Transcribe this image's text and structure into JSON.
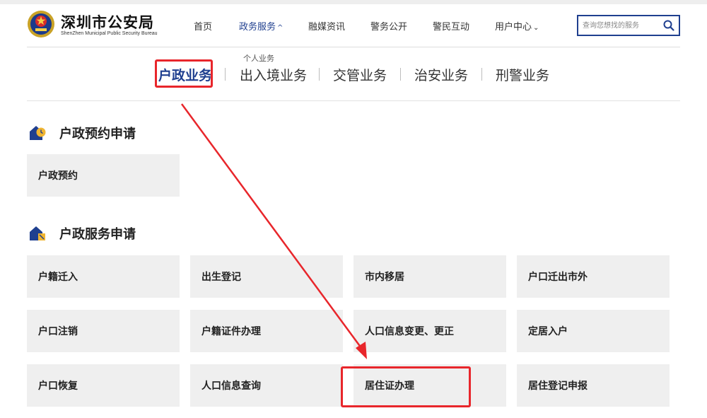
{
  "header": {
    "title": "深圳市公安局",
    "subtitle": "ShenZhen Municipal Public Security Bureau",
    "nav": [
      {
        "label": "首页"
      },
      {
        "label": "政务服务",
        "chevron": "^"
      },
      {
        "label": "融媒资讯"
      },
      {
        "label": "警务公开"
      },
      {
        "label": "警民互动"
      },
      {
        "label": "用户中心",
        "chevron": "⌄"
      }
    ],
    "submenu_label": "个人业务",
    "search": {
      "placeholder": "查询您想找的服务"
    }
  },
  "categories": [
    "户政业务",
    "出入境业务",
    "交管业务",
    "治安业务",
    "刑警业务"
  ],
  "sections": [
    {
      "title": "户政预约申请",
      "items": [
        "户政预约"
      ]
    },
    {
      "title": "户政服务申请",
      "items": [
        "户籍迁入",
        "出生登记",
        "市内移居",
        "户口迁出市外",
        "户口注销",
        "户籍证件办理",
        "人口信息变更、更正",
        "定居入户",
        "户口恢复",
        "人口信息查询",
        "居住证办理",
        "居住登记申报"
      ]
    }
  ],
  "colors": {
    "accent": "#1f3f8f",
    "annotation": "#e8262b",
    "tile_bg": "#efefef"
  },
  "icons": [
    "police-emblem-icon",
    "search-icon",
    "appointment-icon",
    "household-service-icon",
    "arrow-annotation"
  ]
}
